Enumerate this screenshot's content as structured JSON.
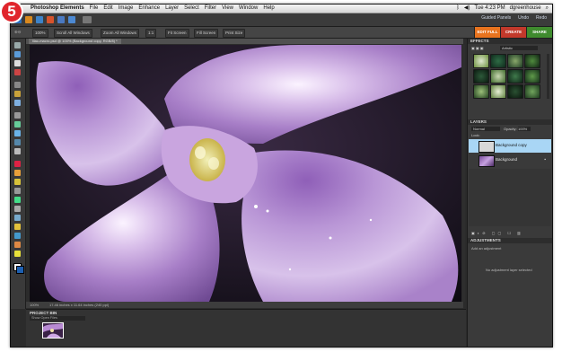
{
  "step_badge": "5",
  "menubar": {
    "apple": "",
    "app_name": "Photoshop Elements",
    "menus": [
      "File",
      "Edit",
      "Image",
      "Enhance",
      "Layer",
      "Select",
      "Filter",
      "View",
      "Window",
      "Help"
    ],
    "clock": "Tue 4:23 PM",
    "user": "dgreenhouse"
  },
  "appbar": {
    "links": [
      "Guided Panels",
      "Undo",
      "Redo"
    ]
  },
  "options_bar": {
    "items": [
      "100%",
      "Scroll All Windows",
      "Zoom All Windows",
      "1:1",
      "Fit Screen",
      "Fill Screen",
      "Print Size"
    ]
  },
  "modes": [
    {
      "label": "EDIT FULL",
      "color": "#e8731e"
    },
    {
      "label": "CREATE",
      "color": "#c2392b"
    },
    {
      "label": "SHARE",
      "color": "#3f8b2e"
    }
  ],
  "document": {
    "tab_title": "lilac-macro.psd @ 100% (Background copy, RGB/8) *",
    "status": "17.46 inches x 11.64 inches (240 ppi)",
    "zoom": "100%"
  },
  "project_bin": {
    "title": "PROJECT BIN",
    "selector": "Show Open Files"
  },
  "effects_panel": {
    "title": "EFFECTS",
    "dropdown": "Artistic"
  },
  "layers_panel": {
    "title": "LAYERS",
    "blend_mode": "Normal",
    "opacity_label": "Opacity:",
    "opacity": "100%",
    "lock_label": "Lock:",
    "layers": [
      {
        "name": "Background copy",
        "selected": true
      },
      {
        "name": "Background",
        "selected": false
      }
    ]
  },
  "adjustments_panel": {
    "title": "ADJUSTMENTS",
    "subtitle": "Add an adjustment",
    "note": "No adjustment layer selected"
  }
}
